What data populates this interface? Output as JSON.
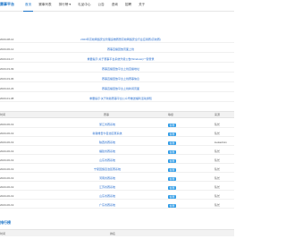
{
  "header": {
    "brand": "赛事平台",
    "nav": [
      "首页",
      "赛事列表",
      "排行榜 ▾",
      "礼品中心",
      "公告",
      "咨询",
      "招聘",
      "关于"
    ]
  },
  "notices": [
    {
      "date": "2023-08-14",
      "title": "2023年高校网络安全管理运维赛暨高校网络安全行业应用赛(高校赛)"
    },
    {
      "date": "2023-06-12",
      "title": "赛事直播回放页面上线"
    },
    {
      "date": "2023-04-17",
      "title": "重要提示:关于赛事平台系统升级公告(Windows)一键登录"
    },
    {
      "date": "2023-03-09",
      "title": "赛事直播回放平台上线直播地址"
    },
    {
      "date": "2023-03-06",
      "title": "赛事直播回放平台上线赛事信息"
    },
    {
      "date": "2023-02-23",
      "title": "赛事直播回放平台上线新闻页面"
    },
    {
      "date": "2023-01-08",
      "title": "重要提示:关于新版赛事平台公众号推送福利活动通知"
    }
  ],
  "events_header": {
    "time": "时间",
    "name": "赛事",
    "level": "等级",
    "source": "来源"
  },
  "events": [
    {
      "date": "2023-06-19",
      "name": "浙江省赛系统",
      "level": "省赛",
      "source": "队长"
    },
    {
      "date": "2023-06-19",
      "name": "新疆维吾尔自治区赛系统",
      "level": "省赛",
      "source": "队长"
    },
    {
      "date": "2023-06-19",
      "name": "陕西省赛系统",
      "level": "省赛",
      "source": "lookadmin"
    },
    {
      "date": "2023-06-19",
      "name": "福建省赛系统",
      "level": "省赛",
      "source": "队长"
    },
    {
      "date": "2023-06-19",
      "name": "山东省赛系统",
      "level": "省赛",
      "source": "队长"
    },
    {
      "date": "2023-06-19",
      "name": "宁夏回族自治区赛系统",
      "level": "省赛",
      "source": "队长"
    },
    {
      "date": "2023-06-19",
      "name": "河南省赛系统",
      "level": "省赛",
      "source": "队长"
    },
    {
      "date": "2023-06-19",
      "name": "江苏省赛系统",
      "level": "省赛",
      "source": "队长"
    },
    {
      "date": "2023-06-19",
      "name": "山东省赛系统",
      "level": "省赛",
      "source": "队长"
    },
    {
      "date": "2023-06-19",
      "name": "广东省赛系统",
      "level": "省赛",
      "source": "队长"
    }
  ],
  "bottom": {
    "title": "排行榜",
    "col1": "时间",
    "col2": "排名"
  },
  "colors": {
    "accent": "#1a73c7",
    "badge": "#2e9be6",
    "link": "#2a6fcf"
  }
}
